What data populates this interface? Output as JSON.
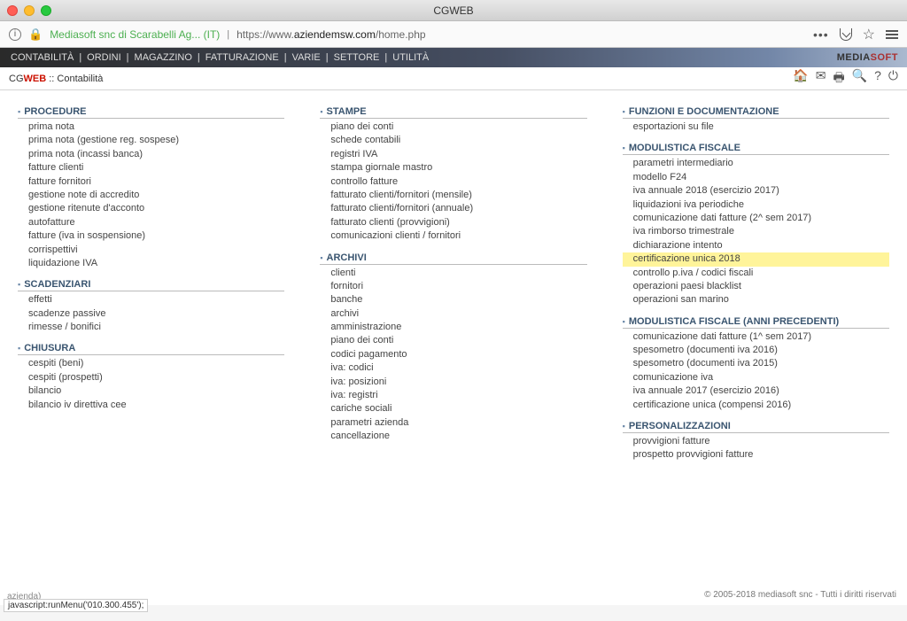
{
  "window": {
    "title": "CGWEB"
  },
  "address": {
    "sitename": "Mediasoft snc di Scarabelli Ag... (IT)",
    "url_prefix": "https://www.",
    "url_domain": "aziendemsw.com",
    "url_path": "/home.php"
  },
  "menu": [
    "CONTABILITÀ",
    "ORDINI",
    "MAGAZZINO",
    "FATTURAZIONE",
    "VARIE",
    "SETTORE",
    "UTILITÀ"
  ],
  "brand": {
    "m": "MEDIA",
    "s": "SOFT"
  },
  "sub": {
    "cg": "CG",
    "web": "WEB",
    "sep": " :: ",
    "page": "Contabilità"
  },
  "col1": [
    {
      "title": "PROCEDURE",
      "items": [
        "prima nota",
        "prima nota (gestione reg. sospese)",
        "prima nota (incassi banca)",
        "fatture clienti",
        "fatture fornitori",
        "gestione note di accredito",
        "gestione ritenute d'acconto",
        "autofatture",
        "fatture (iva in sospensione)",
        "corrispettivi",
        "liquidazione IVA"
      ]
    },
    {
      "title": "SCADENZIARI",
      "items": [
        "effetti",
        "scadenze passive",
        "rimesse / bonifici"
      ]
    },
    {
      "title": "CHIUSURA",
      "items": [
        "cespiti (beni)",
        "cespiti (prospetti)",
        "bilancio",
        "bilancio iv direttiva cee"
      ]
    }
  ],
  "col2": [
    {
      "title": "STAMPE",
      "items": [
        "piano dei conti",
        "schede contabili",
        "registri IVA",
        "stampa giornale mastro",
        "controllo fatture",
        "fatturato clienti/fornitori (mensile)",
        "fatturato clienti/fornitori (annuale)",
        "fatturato clienti (provvigioni)",
        "comunicazioni clienti / fornitori"
      ]
    },
    {
      "title": "ARCHIVI",
      "items": [
        "clienti",
        "fornitori",
        "banche",
        "archivi",
        "amministrazione",
        "piano dei conti",
        "codici pagamento",
        "iva: codici",
        "iva: posizioni",
        "iva: registri",
        "cariche sociali",
        "parametri azienda",
        "cancellazione"
      ]
    }
  ],
  "col3": [
    {
      "title": "FUNZIONI E DOCUMENTAZIONE",
      "items": [
        "esportazioni su file"
      ]
    },
    {
      "title": "MODULISTICA FISCALE",
      "items": [
        "parametri intermediario",
        "modello F24",
        "iva annuale 2018 (esercizio 2017)",
        "liquidazioni iva periodiche",
        "comunicazione dati fatture (2^ sem 2017)",
        "iva rimborso trimestrale",
        "dichiarazione intento",
        "certificazione unica 2018",
        "controllo p.iva / codici fiscali",
        "operazioni paesi blacklist",
        "operazioni san marino"
      ]
    },
    {
      "title": "MODULISTICA FISCALE (ANNI PRECEDENTI)",
      "items": [
        "comunicazione dati fatture (1^ sem 2017)",
        "spesometro (documenti iva 2016)",
        "spesometro (documenti iva 2015)",
        "comunicazione iva",
        "iva annuale 2017 (esercizio 2016)",
        "certificazione unica (compensi 2016)"
      ]
    },
    {
      "title": "PERSONALIZZAZIONI",
      "items": [
        "provvigioni fatture",
        "prospetto provvigioni fatture"
      ]
    }
  ],
  "highlight": "certificazione unica 2018",
  "footer": "© 2005-2018 mediasoft snc - Tutti i diritti riservati",
  "status": {
    "note": "azienda)",
    "js": "javascript:runMenu('010.300.455');"
  }
}
